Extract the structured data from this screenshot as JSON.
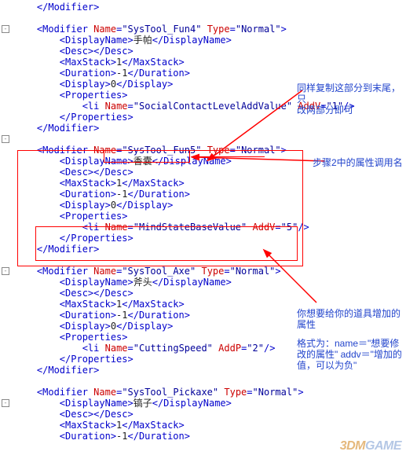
{
  "code": {
    "l0": "</Modifier>",
    "fun4": {
      "open_tag": "<Modifier",
      "name_attr": "Name",
      "name_val": "\"SysTool_Fun4\"",
      "type_attr": "Type",
      "type_val": "\"Normal\"",
      "close": ">",
      "display_open": "<DisplayName>",
      "display_text": "手帕",
      "display_close": "</DisplayName>",
      "desc": "<Desc></Desc>",
      "maxstack_open": "<MaxStack>",
      "maxstack_val": "1",
      "maxstack_close": "</MaxStack>",
      "duration_open": "<Duration>",
      "duration_val": "-1",
      "duration_close": "</Duration>",
      "display2_open": "<Display>",
      "display2_val": "0",
      "display2_close": "</Display>",
      "props_open": "<Properties>",
      "li_open": "<li",
      "li_name_attr": "Name",
      "li_name_val": "\"SocialContactLevelAddValue\"",
      "li_addv_attr": "AddV",
      "li_addv_val": "\"1\"",
      "li_close": "/>",
      "props_close": "</Properties>",
      "close_tag": "</Modifier>"
    },
    "fun5": {
      "open_tag": "<Modifier",
      "name_attr": "Name",
      "name_val": "\"SysTool_Fun5\"",
      "type_attr": "Type",
      "type_val": "\"Normal\"",
      "close": ">",
      "display_open": "<DisplayName>",
      "display_text": "香囊",
      "display_close": "</DisplayName>",
      "desc": "<Desc></Desc>",
      "maxstack_open": "<MaxStack>",
      "maxstack_val": "1",
      "maxstack_close": "</MaxStack>",
      "duration_open": "<Duration>",
      "duration_val": "-1",
      "duration_close": "</Duration>",
      "display2_open": "<Display>",
      "display2_val": "0",
      "display2_close": "</Display>",
      "props_open": "<Properties>",
      "li_open": "<li",
      "li_name_attr": "Name",
      "li_name_val": "\"MindStateBaseValue\"",
      "li_addv_attr": "AddV",
      "li_addv_val": "\"5\"",
      "li_close": "/>",
      "props_close": "</Properties>",
      "close_tag": "</Modifier>"
    },
    "axe": {
      "open_tag": "<Modifier",
      "name_attr": "Name",
      "name_val": "\"SysTool_Axe\"",
      "type_attr": "Type",
      "type_val": "\"Normal\"",
      "close": ">",
      "display_open": "<DisplayName>",
      "display_text": "斧头",
      "display_close": "</DisplayName>",
      "desc": "<Desc></Desc>",
      "maxstack_open": "<MaxStack>",
      "maxstack_val": "1",
      "maxstack_close": "</MaxStack>",
      "duration_open": "<Duration>",
      "duration_val": "-1",
      "duration_close": "</Duration>",
      "display2_open": "<Display>",
      "display2_val": "0",
      "display2_close": "</Display>",
      "props_open": "<Properties>",
      "li_open": "<li",
      "li_name_attr": "Name",
      "li_name_val": "\"CuttingSpeed\"",
      "li_addp_attr": "AddP",
      "li_addp_val": "\"2\"",
      "li_close": "/>",
      "props_close": "</Properties>",
      "close_tag": "</Modifier>"
    },
    "pickaxe": {
      "open_tag": "<Modifier",
      "name_attr": "Name",
      "name_val": "\"SysTool_Pickaxe\"",
      "type_attr": "Type",
      "type_val": "\"Normal\"",
      "close": ">",
      "display_open": "<DisplayName>",
      "display_text": "镐子",
      "display_close": "</DisplayName>",
      "desc": "<Desc></Desc>",
      "maxstack_open": "<MaxStack>",
      "maxstack_val": "1",
      "maxstack_close": "</MaxStack>",
      "duration_open": "<Duration>",
      "duration_val": "-1",
      "duration_close": "</Duration>"
    }
  },
  "annotations": {
    "a1_l1": "同样复制这部分到末尾，只",
    "a1_l2": "改两部分即可",
    "a2": "步骤2中的属性调用名",
    "a3_l1": "你想要给你的道具增加的",
    "a3_l2": "属性",
    "a4_l1": "格式为：name＝\"想要修",
    "a4_l2": "改的属性\" addv＝\"增加的",
    "a4_l3": "值，可以为负\""
  },
  "watermark": {
    "p1": "3DM",
    "p2": "GAME"
  }
}
